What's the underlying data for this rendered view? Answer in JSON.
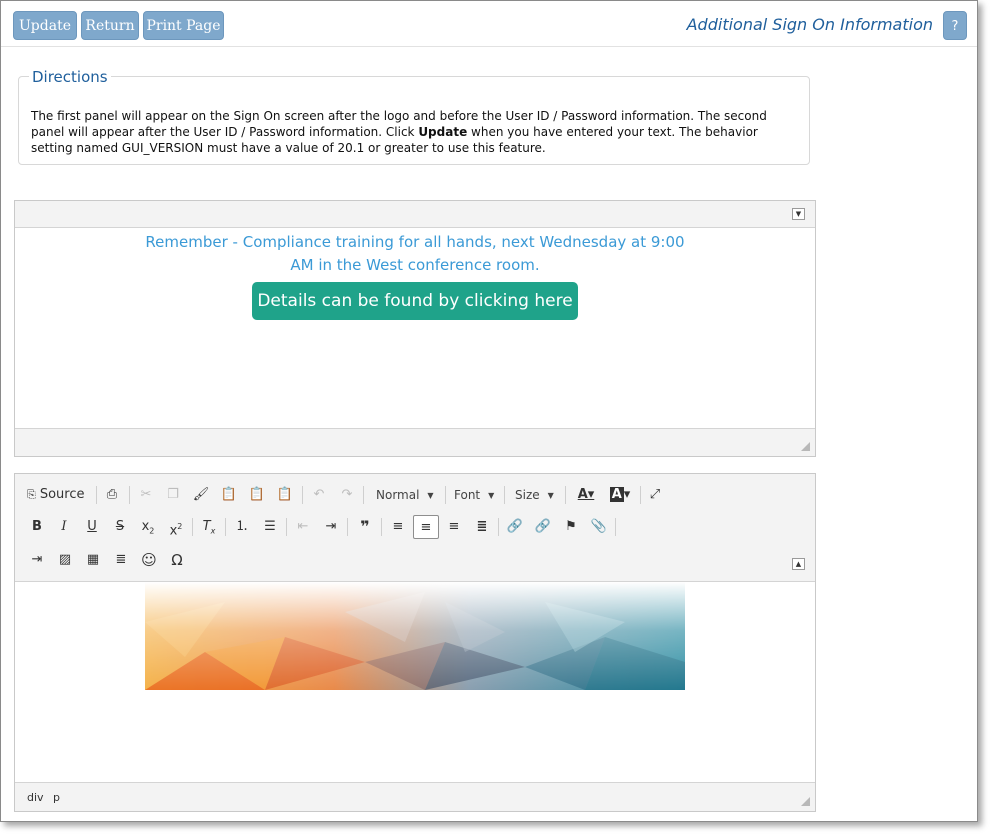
{
  "header": {
    "buttons": {
      "update": "Update",
      "return": "Return",
      "print": "Print Page"
    },
    "title": "Additional Sign On Information",
    "help": "?"
  },
  "directions": {
    "legend": "Directions",
    "text_before": "The first panel will appear on the Sign On screen after the logo and before the User ID / Password information. The second panel will appear after the User ID / Password information. Click ",
    "text_bold": "Update",
    "text_after": " when you have entered your text. The behavior setting named GUI_VERSION must have a value of 20.1 or greater to use this feature."
  },
  "panel1": {
    "message": "Remember - Compliance training for all hands, next Wednesday at 9:00 AM in the West conference room.",
    "button_label": "Details can be found by clicking here",
    "collapse_icon": "triangle-down",
    "colors": {
      "message": "#3b9ad6",
      "button": "#1fa38a"
    }
  },
  "panel2": {
    "toolbar": {
      "source_label": "Source",
      "format_label": "Normal",
      "font_label": "Font",
      "size_label": "Size"
    },
    "banner_image": "polygon-gradient-banner",
    "element_path": [
      "div",
      "p"
    ]
  },
  "colors": {
    "button_bg": "#7fa8cc",
    "title": "#1f5f9c"
  }
}
